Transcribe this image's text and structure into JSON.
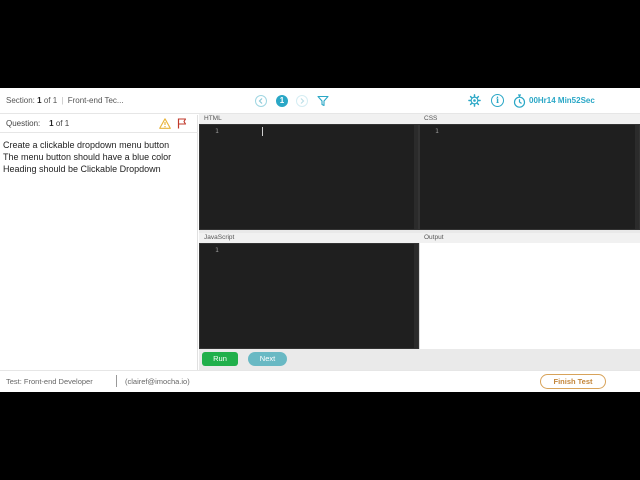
{
  "header": {
    "section_label": "Section:",
    "section_current": "1",
    "section_of": "of 1",
    "section_sep": "|",
    "section_name": "Front-end Tec...",
    "nav_current": "1",
    "timer": "00Hr14 Min52Sec"
  },
  "icons": {
    "prev": "chevron-left-icon",
    "next": "chevron-right-icon",
    "filter": "filter-icon",
    "settings": "gear-icon",
    "info": "info-icon",
    "timer": "stopwatch-icon",
    "warning": "warning-icon",
    "flag": "flag-icon",
    "info_glyph": "i",
    "accent": "#2aa7c6",
    "warning_color": "#e8b33a",
    "flag_color": "#c0392b"
  },
  "question": {
    "label": "Question:",
    "number": "1",
    "of": "of 1",
    "lines": [
      "Create a clickable dropdown menu button",
      "The menu button should have a blue color",
      "Heading should be Clickable Dropdown"
    ]
  },
  "editors": {
    "html_label": "HTML",
    "css_label": "CSS",
    "js_label": "JavaScript",
    "output_label": "Output",
    "line_number": "1"
  },
  "buttons": {
    "run": "Run",
    "next": "Next",
    "finish": "Finish Test",
    "run_color": "#21b04b",
    "next_color": "#69b9c4"
  },
  "footer": {
    "test": "Test: Front-end Developer",
    "user": "(clairef@imocha.io)"
  }
}
